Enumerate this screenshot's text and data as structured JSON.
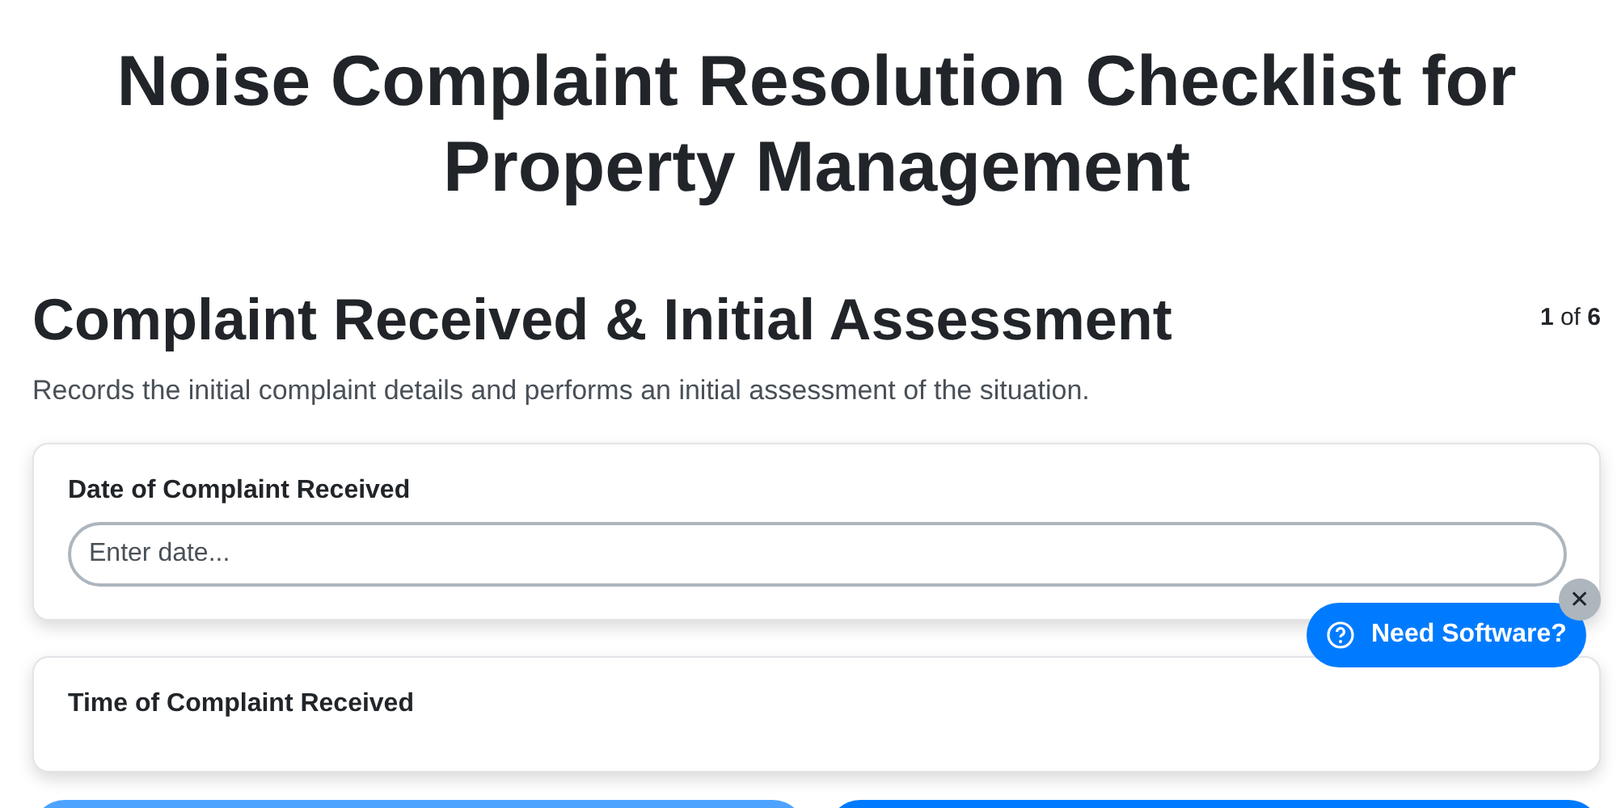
{
  "title": "Noise Complaint Resolution Checklist for Property Management",
  "section": {
    "heading": "Complaint Received & Initial Assessment",
    "step": "**1** of **6**",
    "description": "Records the initial complaint details and performs an initial assessment of the situation."
  },
  "fields": [
    {
      "label": "Date of Complaint Received",
      "placeholder": "Enter date..."
    },
    {
      "label": "Time of Complaint Received"
    }
  ],
  "bottom_buttons": [
    {
      "kind": "secondary"
    },
    {
      "kind": "primary"
    }
  ],
  "help_widget": {
    "label": "Need Software?",
    "close": "✕"
  }
}
